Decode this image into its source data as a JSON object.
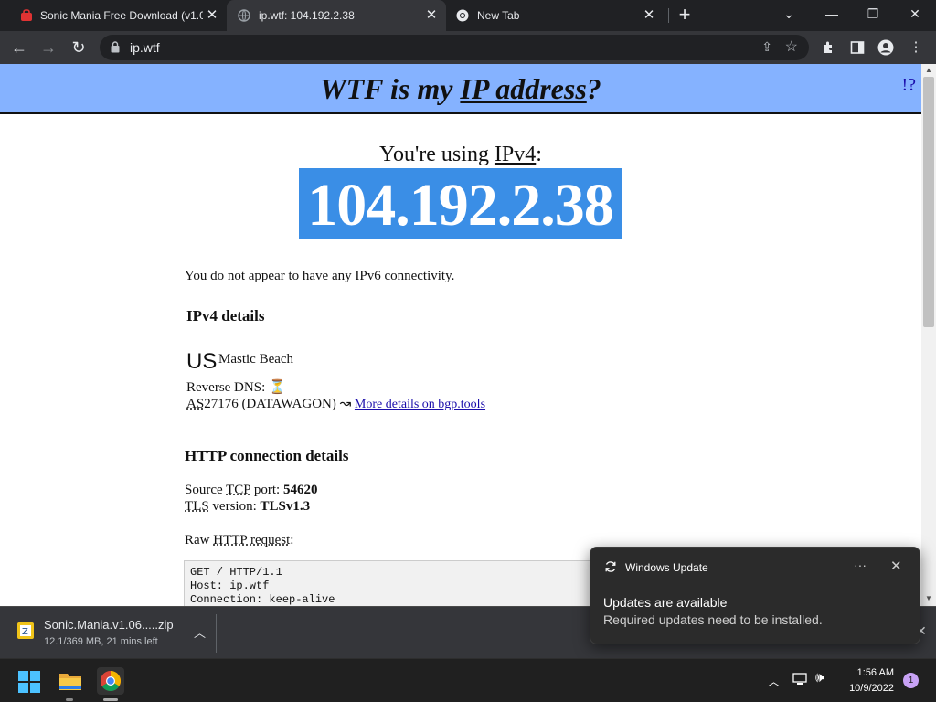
{
  "browser": {
    "tabs": [
      {
        "label": "Sonic Mania Free Download (v1.0"
      },
      {
        "label": "ip.wtf: 104.192.2.38"
      },
      {
        "label": "New Tab"
      }
    ],
    "url": "ip.wtf"
  },
  "page": {
    "title_pre": "WTF is my ",
    "title_link": "IP address",
    "title_post": "?",
    "help_link": "!?",
    "using_pre": "You're using ",
    "using_link": "IPv4",
    "using_post": ":",
    "ip": "104.192.2.38",
    "no_ipv6": "You do not appear to have any IPv6 connectivity.",
    "ipv4_heading": "IPv4 details",
    "country_code": "US",
    "city": "Mastic Beach",
    "reverse_dns_label": "Reverse DNS:",
    "reverse_dns_value": "⏳",
    "asn_abbr": "AS",
    "asn_rest": "27176 (DATAWAGON) ↝ ",
    "asn_link": "More details on bgp.tools",
    "http_heading": "HTTP connection details",
    "source_label_pre": "Source ",
    "source_label_abbr": "TCP",
    "source_label_post": " port: ",
    "source_port": "54620",
    "tls_label_abbr": "TLS",
    "tls_label_post": " version: ",
    "tls_version": "TLSv1.3",
    "raw_label_pre": "Raw ",
    "raw_label_abbr": "HTTP request",
    "raw_label_post": ":",
    "raw_lines": [
      "GET / HTTP/1.1",
      "Host: ip.wtf",
      "Connection: keep-alive"
    ]
  },
  "download": {
    "filename": "Sonic.Mania.v1.06.....zip",
    "status": "12.1/369 MB, 21 mins left"
  },
  "toast": {
    "app": "Windows Update",
    "title": "Updates are available",
    "body": "Required updates need to be installed."
  },
  "taskbar": {
    "time": "1:56 AM",
    "date": "10/9/2022",
    "notification_count": "1"
  },
  "colors": {
    "header_bg": "#85b2ff",
    "ip_highlight": "#3a8ee6",
    "link": "#1a0dab"
  }
}
